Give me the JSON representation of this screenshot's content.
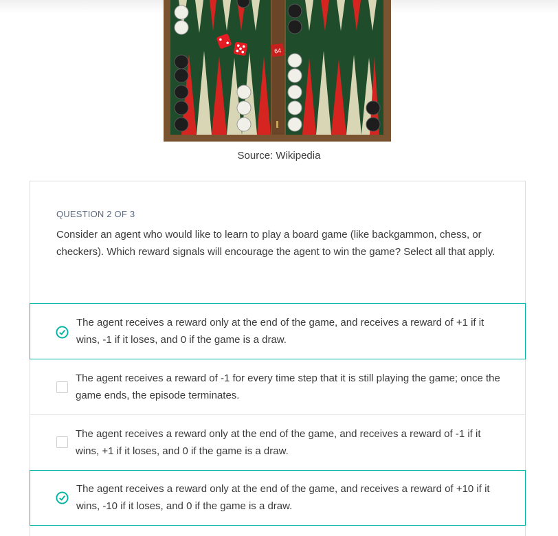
{
  "image": {
    "caption": "Source: Wikipedia",
    "doubling_cube": "64"
  },
  "question": {
    "label": "QUESTION 2 OF 3",
    "text": "Consider an agent who would like to learn to play a board game (like backgammon, chess, or checkers). Which reward signals will encourage the agent to win the game? Select all that apply."
  },
  "options": [
    {
      "text": "The agent receives a reward only at the end of the game, and receives a reward of +1 if it wins, -1 if it loses, and 0 if the game is a draw.",
      "selected": true
    },
    {
      "text": "The agent receives a reward of -1 for every time step that it is still playing the game; once the game ends, the episode terminates.",
      "selected": false
    },
    {
      "text": "The agent receives a reward only at the end of the game, and receives a reward of -1 if it wins, +1 if it loses, and 0 if the game is a draw.",
      "selected": false
    },
    {
      "text": "The agent receives a reward only at the end of the game, and receives a reward of +10 if it wins, -10 if it loses, and 0 if the game is a draw.",
      "selected": true
    }
  ],
  "colors": {
    "accent": "#02b3a1",
    "board_felt": "#1f4d2b",
    "board_frame": "#7a5330"
  }
}
